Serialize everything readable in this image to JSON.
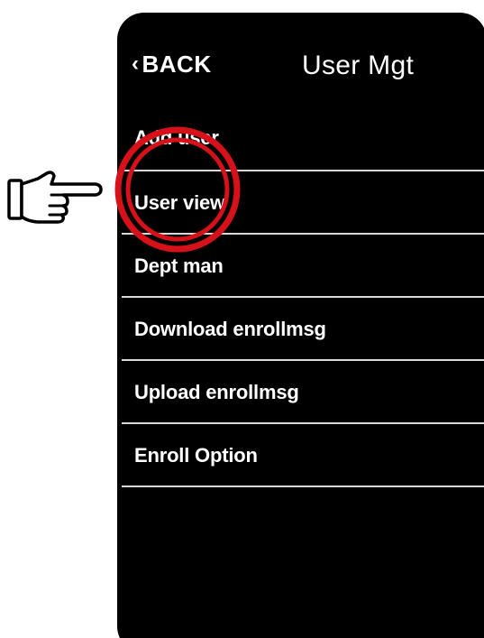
{
  "header": {
    "back_label": "BACK",
    "back_icon": "chevron-left-icon",
    "title": "User Mgt"
  },
  "menu": {
    "items": [
      {
        "label": "Add user"
      },
      {
        "label": "User view",
        "highlighted": true
      },
      {
        "label": "Dept man"
      },
      {
        "label": "Download enrollmsg"
      },
      {
        "label": "Upload enrollmsg"
      },
      {
        "label": "Enroll Option"
      }
    ]
  },
  "annotations": {
    "highlight_icon": "circle-highlight",
    "highlight_color": "#d6111a",
    "pointer_icon": "pointing-hand-icon"
  },
  "colors": {
    "device_background": "#000000",
    "text": "#ffffff",
    "divider": "#d9d9d9",
    "page_background": "#ffffff"
  }
}
